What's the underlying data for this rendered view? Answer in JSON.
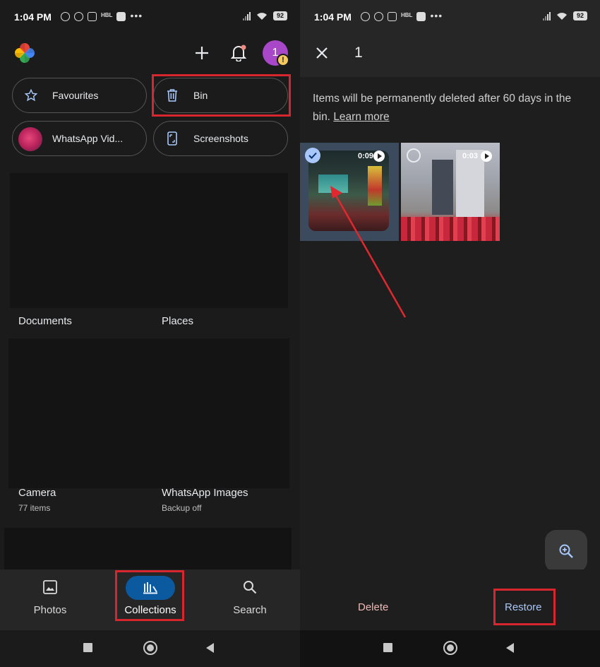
{
  "status_bar": {
    "time": "1:04 PM",
    "battery": "92",
    "extra": "HBL"
  },
  "left": {
    "avatar_initial": "1",
    "warning_badge": "!",
    "chips": [
      {
        "label": "Favourites",
        "icon": "star-icon"
      },
      {
        "label": "Bin",
        "icon": "trash-icon"
      },
      {
        "label": "WhatsApp Vid...",
        "icon": "album-thumbnail"
      },
      {
        "label": "Screenshots",
        "icon": "phone-screenshot-icon"
      }
    ],
    "albums": [
      {
        "title": "Documents",
        "subtitle": ""
      },
      {
        "title": "Places",
        "subtitle": ""
      },
      {
        "title": "Camera",
        "subtitle": "77 items"
      },
      {
        "title": "WhatsApp Images",
        "subtitle": "Backup off"
      }
    ],
    "nav": [
      {
        "label": "Photos",
        "icon": "photo-icon",
        "active": false
      },
      {
        "label": "Collections",
        "icon": "collections-icon",
        "active": true
      },
      {
        "label": "Search",
        "icon": "search-icon",
        "active": false
      }
    ]
  },
  "right": {
    "selected_count": "1",
    "info_text": "Items will be permanently deleted after 60 days in the bin.",
    "learn_more": "Learn more",
    "items": [
      {
        "duration": "0:09",
        "selected": true
      },
      {
        "duration": "0:03",
        "selected": false
      }
    ],
    "actions": {
      "delete": "Delete",
      "restore": "Restore"
    }
  },
  "colors": {
    "background": "#1b1b1b",
    "highlight_box": "#d7262d",
    "active_nav_pill": "#0b5aa0",
    "delete_text": "#f2b8b5",
    "restore_text": "#a8c7fa",
    "avatar": "#a848c8"
  }
}
